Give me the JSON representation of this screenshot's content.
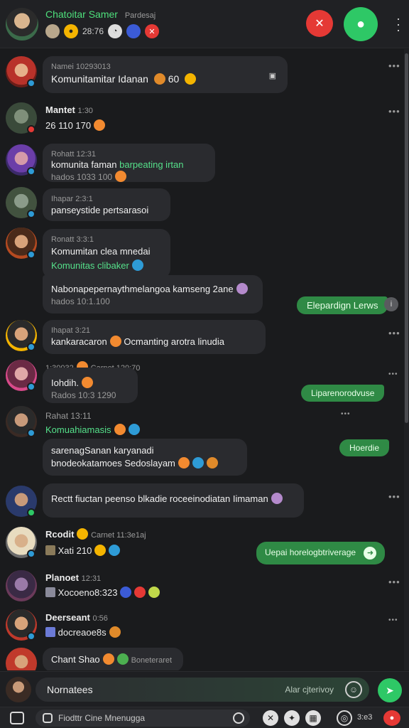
{
  "header": {
    "title": "Chatoitar Samer",
    "title_suffix": "Pardesaj",
    "subtitle": "28:76"
  },
  "compose": {
    "placeholder": "Nornatees",
    "right_text": "Alar cjterivoy"
  },
  "bottom": {
    "field_text": "Fiodttr Cine Mnenugga",
    "right_text": "3:e3"
  },
  "messages": [
    {
      "meta": "Namei 10293013",
      "text": "Komunitamitar Idanan",
      "tail": "60"
    },
    {
      "name": "Mantet",
      "meta": "1:30",
      "text": "26 110 170"
    },
    {
      "meta": "Rohatt 12:31",
      "text": "komunita faman",
      "green": "barpeating irtan",
      "sub": "hados 1033 100"
    },
    {
      "meta": "Ihapar 2:3:1",
      "text": "panseystide pertsarasoi"
    },
    {
      "meta": "Ronatt 3:3:1",
      "text": "Komumitan clea mnedai",
      "green": "Komunitas clibaker",
      "text2": "Nabonapepernaythmelangoa kamseng 2ane",
      "sub": "hados 10:1.100"
    },
    {
      "meta": "Ihapat 3:21",
      "text": "kankaracaron",
      "text2": "Ocmanting arotra linudia"
    },
    {
      "meta": "1:30032",
      "meta2": "Carnet 120:70",
      "text": "Iohdih.",
      "sub": "Rados 10:3 1290"
    },
    {
      "meta": "Rahat 13:11",
      "green": "Komuahiamasis",
      "text": "sarenagSanan karyanadi",
      "text2": "bnodeokatamoes Sedoslayam"
    },
    {
      "text": "Rectt fiuctan peenso blkadie roceeinodiatan Iimaman"
    },
    {
      "name": "Rcodit",
      "meta": "Carnet 11:3e1aj",
      "text": "Xati 210"
    },
    {
      "name": "Planoet",
      "meta": "12:31",
      "text": "Xocoeno8:323"
    },
    {
      "name": "Deerseant",
      "meta": "0:56",
      "text": "docreaoe8s"
    },
    {
      "text": "Chant Shao",
      "text2": "Boneteraret"
    }
  ],
  "sent": [
    "Elepardign Lerws",
    "Liparenorodvuse",
    "Hoerdie",
    "Uepai horelogbtriverage"
  ],
  "colors": {
    "accent_green": "#2ec866",
    "bubble_sent": "#2f8a45",
    "danger": "#e53935",
    "bubble_in": "#2a2b2f"
  }
}
